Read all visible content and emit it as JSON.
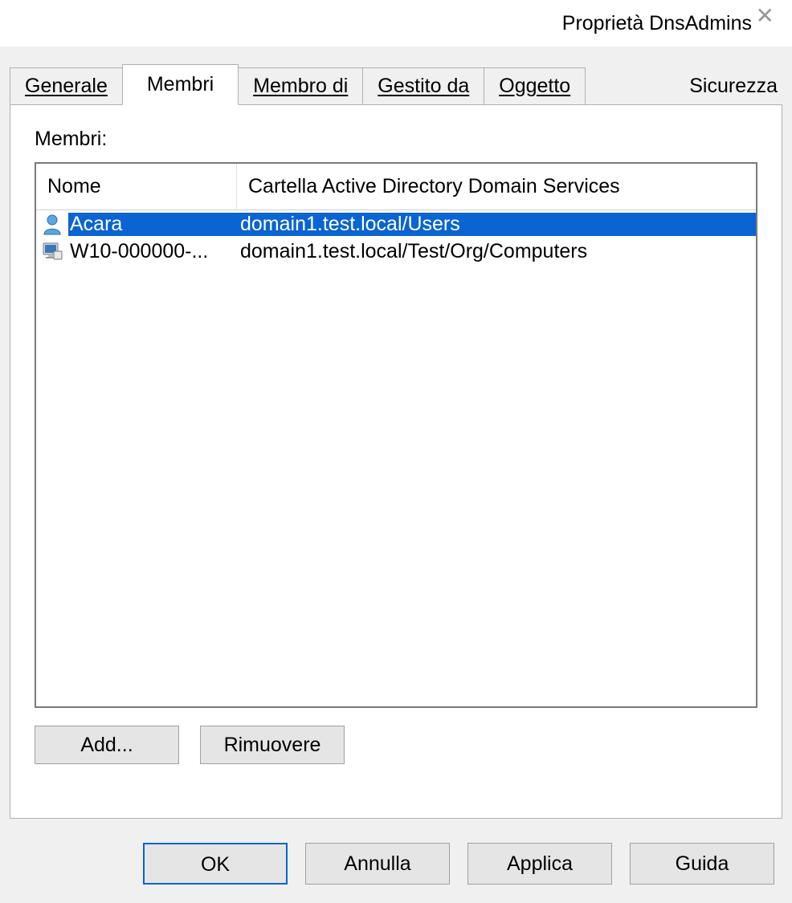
{
  "titlebar": {
    "title": "Proprietà DnsAdmins"
  },
  "tabs": {
    "generale": "Generale",
    "membri": "Membri",
    "membro_di": "Membro di",
    "gestito_da": "Gestito da",
    "oggetto": "Oggetto",
    "sicurezza": "Sicurezza"
  },
  "panel": {
    "label": "Membri:",
    "columns": {
      "name": "Nome",
      "folder": "Cartella Active Directory Domain Services"
    },
    "rows": [
      {
        "icon": "user",
        "name": "Acara",
        "folder": "domain1.test.local/Users",
        "selected": true
      },
      {
        "icon": "computer",
        "name": "W10-000000-...",
        "folder": "domain1.test.local/Test/Org/Computers",
        "selected": false
      }
    ],
    "add_label": "Add...",
    "remove_label": "Rimuovere"
  },
  "dialog_buttons": {
    "ok": "OK",
    "cancel": "Annulla",
    "apply": "Applica",
    "help": "Guida"
  }
}
